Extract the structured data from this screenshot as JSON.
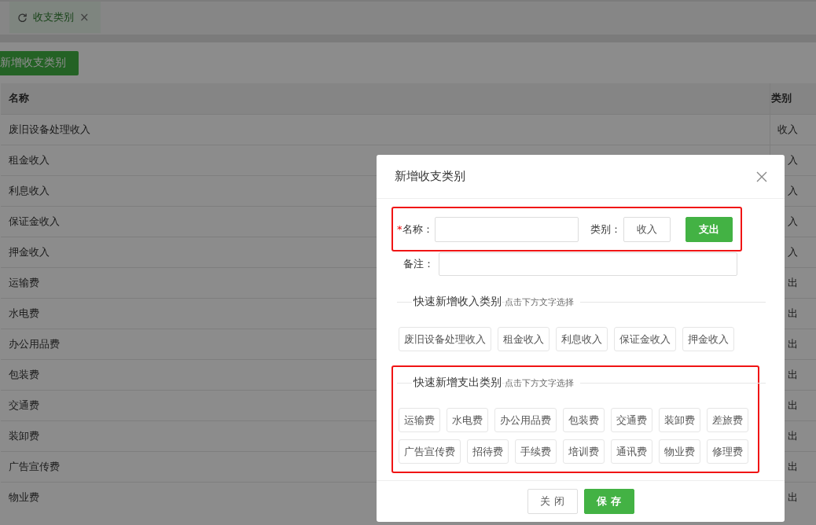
{
  "tab": {
    "label": "收支类别",
    "close": "×"
  },
  "add_button": "新增收支类别",
  "table": {
    "columns": [
      "名称",
      "类别"
    ],
    "rows": [
      {
        "name": "废旧设备处理收入",
        "type": "收入"
      },
      {
        "name": "租金收入",
        "type": "入"
      },
      {
        "name": "利息收入",
        "type": "入"
      },
      {
        "name": "保证金收入",
        "type": "入"
      },
      {
        "name": "押金收入",
        "type": "入"
      },
      {
        "name": "运输费",
        "type": "出"
      },
      {
        "name": "水电费",
        "type": "出"
      },
      {
        "name": "办公用品费",
        "type": "出"
      },
      {
        "name": "包装费",
        "type": "出"
      },
      {
        "name": "交通费",
        "type": "出"
      },
      {
        "name": "装卸费",
        "type": "出"
      },
      {
        "name": "广告宣传费",
        "type": "出"
      },
      {
        "name": "物业费",
        "type": "出"
      }
    ]
  },
  "dialog": {
    "title": "新增收支类别",
    "name_row_highlighted": true,
    "name_required_mark": "*",
    "name_label": "名称：",
    "type_label": "类别：",
    "type_options": [
      {
        "label": "收入",
        "selected": false
      },
      {
        "label": "支出",
        "selected": true
      }
    ],
    "remark_label": "备注：",
    "sections": [
      {
        "title": "快速新增收入类别",
        "hint": "点击下方文字选择",
        "highlighted": false,
        "items": [
          "废旧设备处理收入",
          "租金收入",
          "利息收入",
          "保证金收入",
          "押金收入"
        ]
      },
      {
        "title": "快速新增支出类别",
        "hint": "点击下方文字选择",
        "highlighted": true,
        "items": [
          "运输费",
          "水电费",
          "办公用品费",
          "包装费",
          "交通费",
          "装卸费",
          "差旅费",
          "广告宣传费",
          "招待费",
          "手续费",
          "培训费",
          "通讯费",
          "物业费",
          "修理费"
        ]
      }
    ],
    "buttons": [
      {
        "label": "关 闭",
        "kind": "default"
      },
      {
        "label": "保 存",
        "kind": "primary"
      }
    ]
  }
}
